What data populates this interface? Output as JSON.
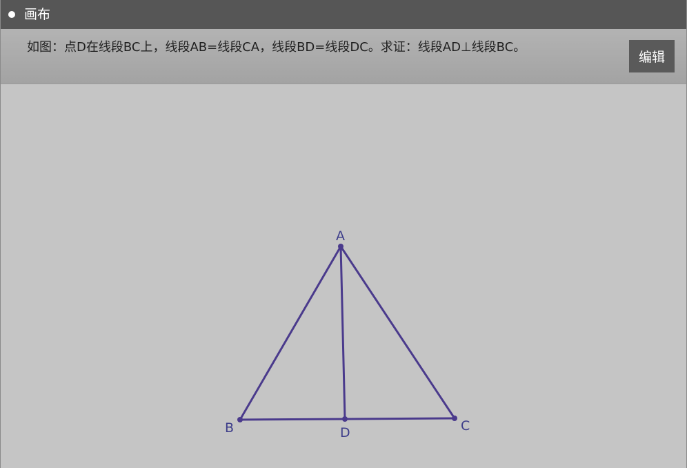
{
  "header": {
    "title": "画布",
    "bullet_icon": "circle-bullet-icon"
  },
  "problem": {
    "text": "如图：点D在线段BC上，线段AB=线段CA，线段BD=线段DC。求证：线段AD⊥线段BC。",
    "edit_label": "编辑"
  },
  "figure": {
    "stroke_color": "#4a3a8c",
    "label_color": "#3d3d8a",
    "points": [
      {
        "name": "A",
        "label": "A"
      },
      {
        "name": "B",
        "label": "B"
      },
      {
        "name": "C",
        "label": "C"
      },
      {
        "name": "D",
        "label": "D"
      }
    ],
    "segments": [
      {
        "name": "AB"
      },
      {
        "name": "AC"
      },
      {
        "name": "BC"
      },
      {
        "name": "AD"
      }
    ]
  }
}
